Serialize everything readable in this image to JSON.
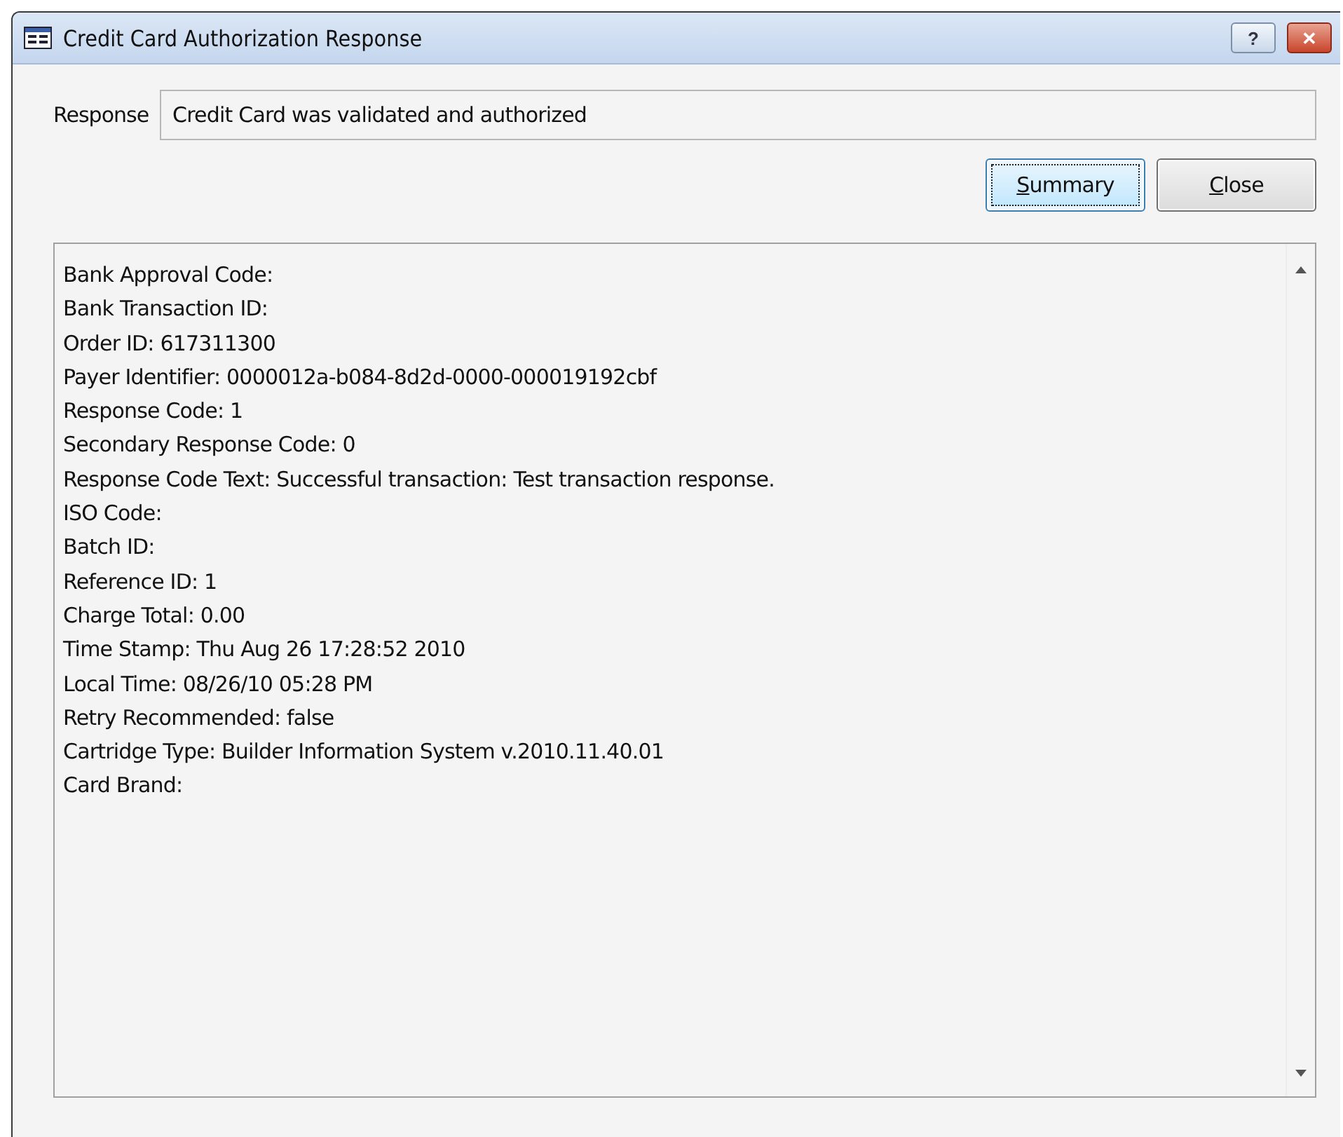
{
  "window": {
    "title": "Credit Card Authorization Response",
    "controls": [
      {
        "kind": "help",
        "label": "?"
      },
      {
        "kind": "close",
        "label": "✕"
      }
    ]
  },
  "response": {
    "label": "Response",
    "value": "Credit Card was validated and authorized"
  },
  "buttons": [
    {
      "label": "Summary",
      "focused": true
    },
    {
      "label": "Close",
      "focused": false
    }
  ],
  "details": {
    "lines": [
      "Bank Approval Code:",
      "Bank Transaction ID:",
      "Order ID: 617311300",
      "Payer Identifier: 0000012a-b084-8d2d-0000-000019192cbf",
      "Response Code: 1",
      "Secondary Response Code: 0",
      "Response Code Text: Successful transaction: Test transaction response.",
      "ISO Code:",
      "Batch ID:",
      "Reference ID: 1",
      "Charge Total: 0.00",
      "Time Stamp: Thu Aug 26 17:28:52 2010",
      "Local Time: 08/26/10 05:28 PM",
      "Retry Recommended: false",
      "Cartridge Type: Builder Information System v.2010.11.40.01",
      "Card Brand:"
    ]
  }
}
